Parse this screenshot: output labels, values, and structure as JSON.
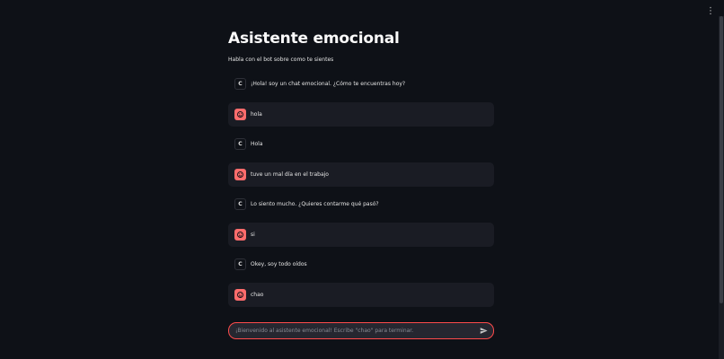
{
  "app": {
    "title": "Asistente emocional",
    "subtitle": "Habla con el bot sobre como te sientes"
  },
  "chat": {
    "messages": [
      {
        "role": "assistant",
        "avatar": "C",
        "text": "¡Hola! soy un chat emocional. ¿Cómo te encuentras hoy?"
      },
      {
        "role": "user",
        "avatar": "smiley-icon",
        "text": "hola"
      },
      {
        "role": "assistant",
        "avatar": "C",
        "text": "Hola"
      },
      {
        "role": "user",
        "avatar": "smiley-icon",
        "text": "tuve un mal día en el trabajo"
      },
      {
        "role": "assistant",
        "avatar": "C",
        "text": "Lo siento mucho. ¿Quieres contarme qué pasó?"
      },
      {
        "role": "user",
        "avatar": "smiley-icon",
        "text": "si"
      },
      {
        "role": "assistant",
        "avatar": "C",
        "text": "Okey, soy todo oídos"
      },
      {
        "role": "user",
        "avatar": "smiley-icon",
        "text": "chao"
      }
    ]
  },
  "input": {
    "placeholder": "¡Bienvenido al asistente emocional! Escribe \"chao\" para terminar.",
    "value": ""
  },
  "icons": {
    "menu": "more-vertical-icon",
    "send": "send-icon",
    "user_avatar": "smiley-icon"
  },
  "colors": {
    "background": "#0e1117",
    "user_message_bg": "#1a1c24",
    "user_avatar": "#ff6c6c",
    "input_border": "#ff4b4b",
    "input_bg": "#262730"
  }
}
